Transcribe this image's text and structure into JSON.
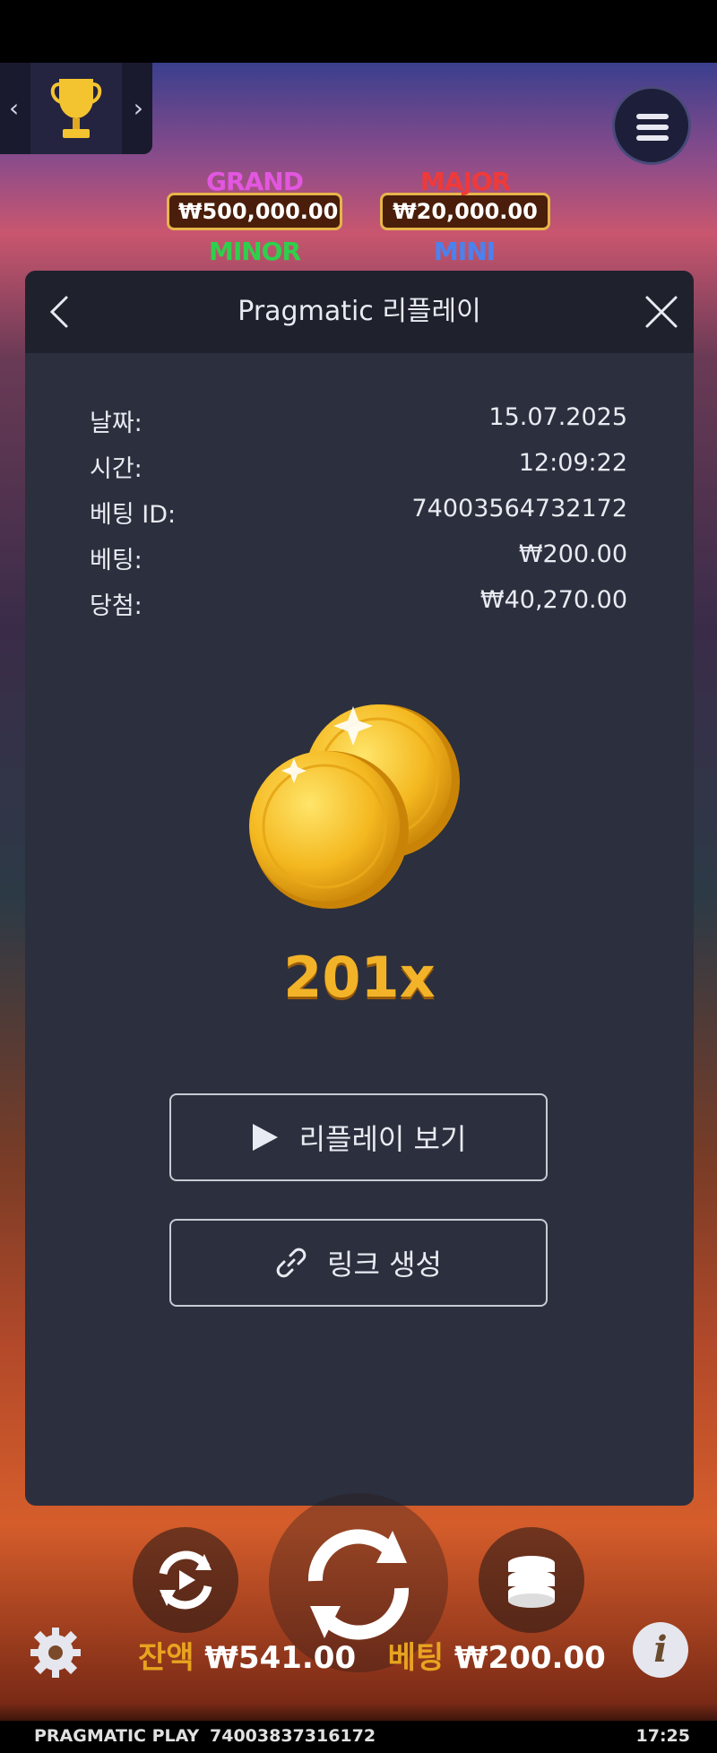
{
  "jackpots": [
    {
      "name": "GRAND",
      "value": "₩500,000.00",
      "color": "#d94bd8"
    },
    {
      "name": "MAJOR",
      "value": "₩20,000.00",
      "color": "#e53030"
    },
    {
      "name": "MINOR",
      "value": "",
      "color": "#2ed04b"
    },
    {
      "name": "MINI",
      "value": "",
      "color": "#3e74e6"
    }
  ],
  "modal": {
    "title": "Pragmatic 리플레이",
    "details": [
      {
        "label": "날짜:",
        "value": "15.07.2025"
      },
      {
        "label": "시간:",
        "value": "12:09:22"
      },
      {
        "label": "베팅 ID:",
        "value": "74003564732172"
      },
      {
        "label": "베팅:",
        "value": "₩200.00"
      },
      {
        "label": "당첨:",
        "value": "₩40,270.00"
      }
    ],
    "multiplier": "201x",
    "play_button": "리플레이 보기",
    "link_button": "링크 생성"
  },
  "bottom": {
    "balance_label": "잔액",
    "balance_value": "₩541.00",
    "bet_label": "베팅",
    "bet_value": "₩200.00",
    "brand": "PRAGMATIC PLAY",
    "round_id": "74003837316172",
    "time": "17:25"
  },
  "colors": {
    "accent": "#f2b329",
    "modal_bg": "#2c2f3d",
    "modal_header": "#1f222d"
  }
}
